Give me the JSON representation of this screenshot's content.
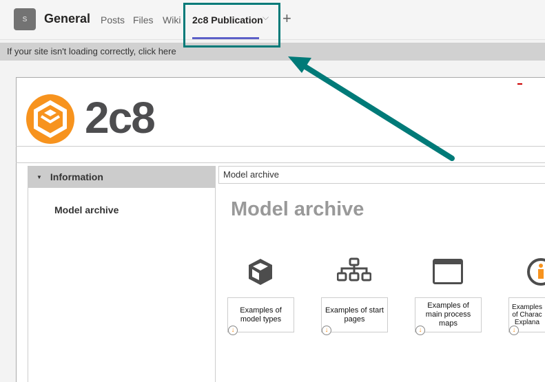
{
  "header": {
    "avatar": "S",
    "channel": "General",
    "tabs": [
      "Posts",
      "Files",
      "Wiki"
    ],
    "active_tab": "2c8 Publication",
    "chevron": "⌵",
    "add": "+"
  },
  "notice": "If your site isn't loading correctly, click here",
  "app": {
    "logo_text": "2c8",
    "brand_color": "#f7931e",
    "accent_color": "#007a78"
  },
  "sidebar": {
    "header": "Information",
    "items": [
      "Model archive"
    ]
  },
  "breadcrumb": "Model archive",
  "page_title": "Model archive",
  "cards": [
    {
      "label": "Examples of model types",
      "icon": "cube-icon"
    },
    {
      "label": "Examples of start pages",
      "icon": "hierarchy-icon"
    },
    {
      "label": "Examples of main process maps",
      "icon": "window-icon"
    },
    {
      "label": "Examples of Charac Explana",
      "icon": "info-icon"
    }
  ]
}
